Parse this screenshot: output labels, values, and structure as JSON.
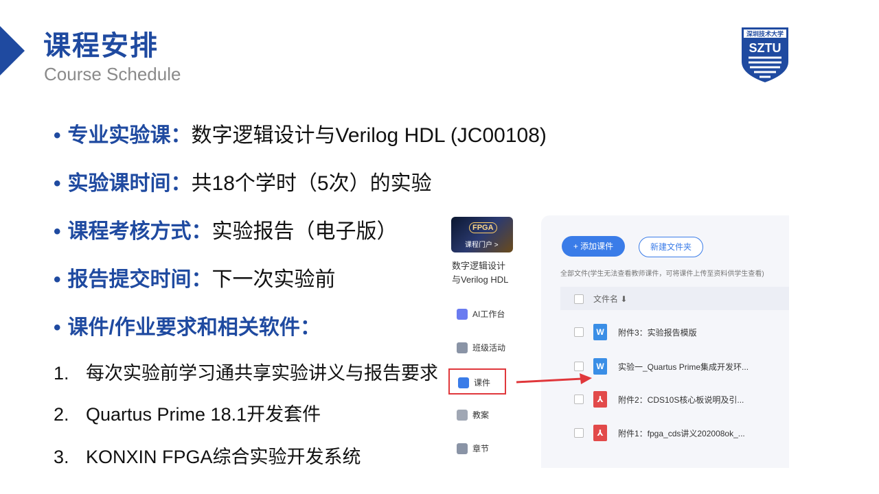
{
  "slide": {
    "title": "课程安排",
    "subtitle": "Course Schedule",
    "logo": {
      "top_text": "深圳技术大学",
      "letters": "SZTU"
    },
    "bullets": [
      {
        "label": "专业实验课：",
        "text": "数字逻辑设计与Verilog HDL (JC00108)"
      },
      {
        "label": "实验课时间：",
        "text": "共18个学时（5次）的实验"
      },
      {
        "label": "课程考核方式：",
        "text": "实验报告（电子版）"
      },
      {
        "label": "报告提交时间：",
        "text": "下一次实验前"
      },
      {
        "label": "课件/作业要求和相关软件：",
        "text": ""
      }
    ],
    "numbered": [
      {
        "num": "1.",
        "text": "每次实验前学习通共享实验讲义与报告要求"
      },
      {
        "num": "2.",
        "text": "Quartus Prime 18.1开发套件"
      },
      {
        "num": "3.",
        "text": "KONXIN FPGA综合实验开发系统"
      }
    ]
  },
  "screenshot": {
    "course_thumb": {
      "badge": "FPGA",
      "portal": "课程门户 >"
    },
    "course_name": [
      "数字逻辑设计",
      "与Verilog HDL"
    ],
    "sidebar": [
      {
        "label": "AI工作台",
        "icon": "ai-workbench-icon",
        "color": "#6a7bf0"
      },
      {
        "label": "班级活动",
        "icon": "class-activity-icon",
        "color": "#8a94a6"
      },
      {
        "label": "课件",
        "icon": "courseware-icon",
        "color": "#3a7ce8"
      },
      {
        "label": "教案",
        "icon": "lesson-plan-icon",
        "color": "#a0a7b4"
      },
      {
        "label": "章节",
        "icon": "chapter-icon",
        "color": "#8a94a6"
      }
    ],
    "add_button": "+ 添加课件",
    "folder_button": "新建文件夹",
    "note": "全部文件(学生无法查看教师课件，可将课件上传至资料供学生查看)",
    "column_header": "文件名 ⬇",
    "files": [
      {
        "name": "附件3：实验报告模版",
        "type": "W"
      },
      {
        "name": "实验一_Quartus Prime集成开发环...",
        "type": "W"
      },
      {
        "name": "附件2：CDS10S核心板说明及引...",
        "type": "pdf"
      },
      {
        "name": "附件1：fpga_cds讲义202008ok_...",
        "type": "pdf"
      }
    ]
  },
  "colors": {
    "accent": "#1f4aa0",
    "highlight_box": "#e0373b",
    "arrow": "#e0373b",
    "primary_button": "#3a7ce8"
  }
}
